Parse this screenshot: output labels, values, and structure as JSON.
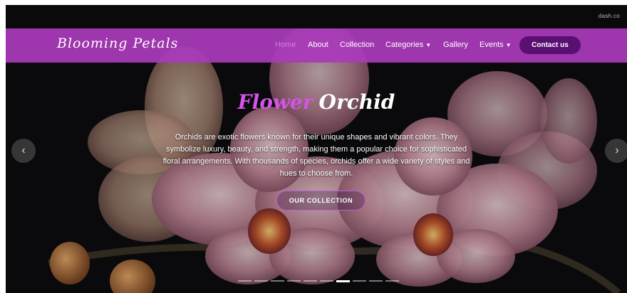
{
  "site": {
    "top_strip_text": "dash.co",
    "brand": "Blooming Petals"
  },
  "nav": {
    "items": [
      {
        "label": "Home",
        "active": true
      },
      {
        "label": "About"
      },
      {
        "label": "Collection"
      },
      {
        "label": "Categories"
      },
      {
        "label": "Gallery"
      },
      {
        "label": "Events"
      }
    ],
    "contact": "Contact us"
  },
  "hero": {
    "title_accent": "Flower",
    "title_main": "Orchid",
    "description": "Orchids are exotic flowers known for their unique shapes and vibrant colors. They symbolize luxury, beauty, and strength, making them a popular choice for sophisticated floral arrangements. With thousands of species, orchids offer a wide variety of styles and hues to choose from.",
    "cta": "OUR COLLECTION",
    "prev_icon": "chevron-left-icon",
    "next_icon": "chevron-right-icon"
  },
  "carousel": {
    "slide_count": 10,
    "active_slide": 6
  },
  "colors": {
    "navbar": "#aa3aba",
    "contact_button": "#5a0f72",
    "accent": "#d354e6"
  }
}
